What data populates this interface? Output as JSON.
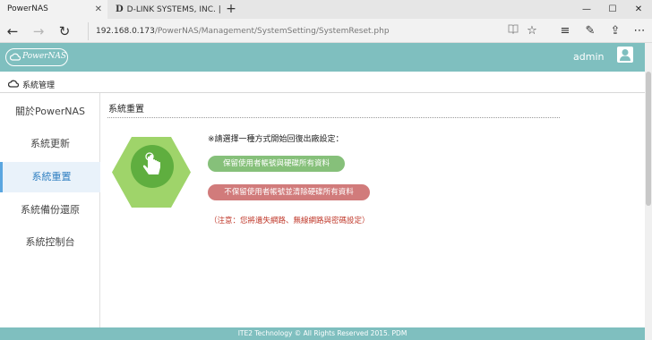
{
  "browser": {
    "tabs": [
      {
        "title": "PowerNAS",
        "active": true
      },
      {
        "title": "D-LINK SYSTEMS, INC. | WIF",
        "active": false
      }
    ],
    "new_tab": "+",
    "url": {
      "host": "192.168.0.173",
      "path": "/PowerNAS/Management/SystemSetting/SystemReset.php"
    },
    "window_controls": {
      "minimize": "—",
      "maximize": "☐",
      "close": "✕"
    }
  },
  "header": {
    "logo_text": "PowerNAS",
    "user": "admin",
    "color": "#7fbfbf"
  },
  "breadcrumb": {
    "label": "系統管理"
  },
  "sidebar": {
    "items": [
      {
        "label": "關於PowerNAS",
        "active": false
      },
      {
        "label": "系統更新",
        "active": false
      },
      {
        "label": "系統重置",
        "active": true
      },
      {
        "label": "系統備份還原",
        "active": false
      },
      {
        "label": "系統控制台",
        "active": false
      }
    ]
  },
  "main": {
    "title": "系統重置",
    "instruction": "※請選擇一種方式開始回復出廠設定：",
    "keep_button": "保留使用者帳號與硬碟所有資料",
    "wipe_button": "不保留使用者帳號並清除硬碟所有資料",
    "warning": "（注意：您將遺失網路、無線網路與密碼設定）",
    "colors": {
      "keep": "#86c07a",
      "wipe": "#d17b7b",
      "hexagon": "#9fd46a",
      "warning": "#c0392b"
    }
  },
  "footer": {
    "text": "ITE2 Technology © All Rights Reserved 2015. PDM"
  },
  "icons": [
    "back-arrow-icon",
    "forward-arrow-icon",
    "refresh-icon",
    "reading-view-icon",
    "favorite-star-icon",
    "hub-icon",
    "note-icon",
    "share-icon",
    "more-icon",
    "cloud-icon",
    "user-avatar-icon",
    "hand-touch-icon"
  ]
}
